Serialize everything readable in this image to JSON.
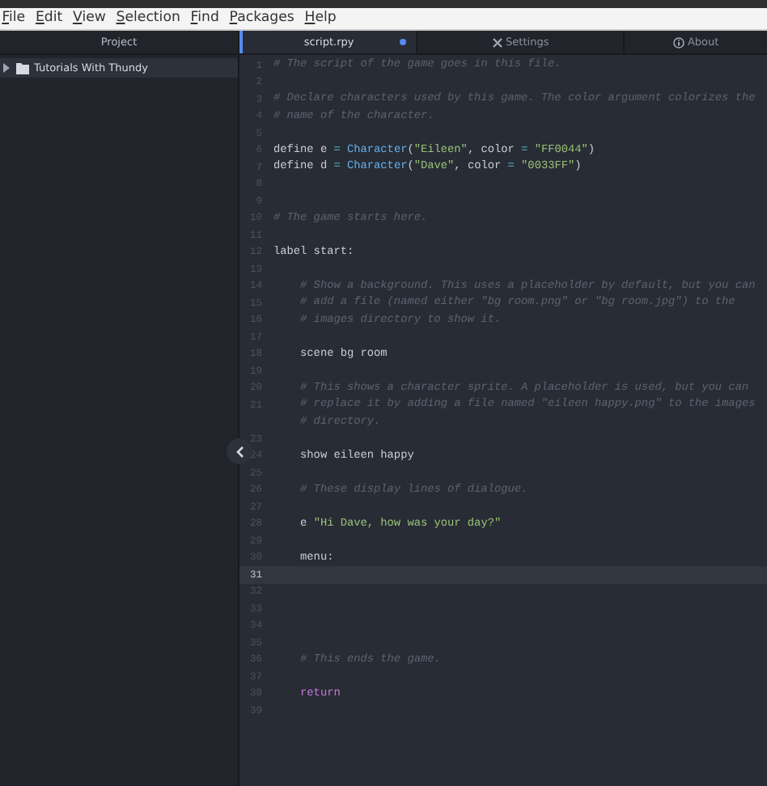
{
  "menu_bar": {
    "items": [
      "File",
      "Edit",
      "View",
      "Selection",
      "Find",
      "Packages",
      "Help"
    ]
  },
  "project_panel": {
    "title": "Project",
    "tree": [
      {
        "label": "Tutorials With Thundy",
        "expanded": false,
        "selected": true
      }
    ]
  },
  "tabs": [
    {
      "label": "script.rpy",
      "kind": "file",
      "selected": true,
      "modified": true
    },
    {
      "label": "Settings",
      "kind": "settings",
      "selected": false,
      "modified": false
    },
    {
      "label": "About",
      "kind": "about",
      "selected": false,
      "modified": false
    }
  ],
  "editor": {
    "lines": [
      {
        "number": "1",
        "current": false,
        "tokens": [
          {
            "kind": "comment",
            "text": "# The script of the game goes in this file."
          }
        ]
      },
      {
        "number": "2",
        "current": false
      },
      {
        "number": "3",
        "current": false,
        "tokens": [
          {
            "kind": "comment",
            "text": "# Declare characters used by this game. The color argument colorizes the"
          }
        ]
      },
      {
        "number": "4",
        "current": false,
        "tokens": [
          {
            "kind": "comment",
            "text": "# name of the character."
          }
        ]
      },
      {
        "number": "5",
        "current": false
      },
      {
        "number": "6",
        "current": false,
        "tokens": [
          {
            "kind": "plain",
            "text": "define e "
          },
          {
            "kind": "op",
            "text": "= "
          },
          {
            "kind": "func",
            "text": "Character"
          },
          {
            "kind": "plain",
            "text": "("
          },
          {
            "kind": "string",
            "text": "\"Eileen\""
          },
          {
            "kind": "plain",
            "text": ", color "
          },
          {
            "kind": "op",
            "text": "= "
          },
          {
            "kind": "string",
            "text": "\"FF0044\""
          },
          {
            "kind": "plain",
            "text": ")"
          }
        ]
      },
      {
        "number": "7",
        "current": false,
        "tokens": [
          {
            "kind": "plain",
            "text": "define d "
          },
          {
            "kind": "op",
            "text": "= "
          },
          {
            "kind": "func",
            "text": "Character"
          },
          {
            "kind": "plain",
            "text": "("
          },
          {
            "kind": "string",
            "text": "\"Dave\""
          },
          {
            "kind": "plain",
            "text": ", color "
          },
          {
            "kind": "op",
            "text": "= "
          },
          {
            "kind": "string",
            "text": "\"0033FF\""
          },
          {
            "kind": "plain",
            "text": ")"
          }
        ]
      },
      {
        "number": "8",
        "current": false
      },
      {
        "number": "9",
        "current": false
      },
      {
        "number": "10",
        "current": false,
        "tokens": [
          {
            "kind": "comment",
            "text": "# The game starts here."
          }
        ]
      },
      {
        "number": "11",
        "current": false
      },
      {
        "number": "12",
        "current": false,
        "tokens": [
          {
            "kind": "plain",
            "text": "label start:"
          }
        ]
      },
      {
        "number": "13",
        "current": false
      },
      {
        "number": "14",
        "current": false,
        "tokens": [
          {
            "kind": "comment",
            "text": "    # Show a background. This uses a placeholder by default, but you can"
          }
        ]
      },
      {
        "number": "15",
        "current": false,
        "tokens": [
          {
            "kind": "comment",
            "text": "    # add a file (named either \"bg room.png\" or \"bg room.jpg\") to the"
          }
        ]
      },
      {
        "number": "16",
        "current": false,
        "tokens": [
          {
            "kind": "comment",
            "text": "    # images directory to show it."
          }
        ]
      },
      {
        "number": "17",
        "current": false
      },
      {
        "number": "18",
        "current": false,
        "tokens": [
          {
            "kind": "plain",
            "text": "    scene bg room"
          }
        ]
      },
      {
        "number": "19",
        "current": false
      },
      {
        "number": "20",
        "current": false,
        "tokens": [
          {
            "kind": "comment",
            "text": "    # This shows a character sprite. A placeholder is used, but you can"
          }
        ]
      },
      {
        "number": "21",
        "current": false,
        "tokens": [
          {
            "kind": "comment",
            "text": "    # replace it by adding a file named \"eileen happy.png\" to the images"
          }
        ]
      },
      {
        "tokens": [
          {
            "kind": "comment",
            "text": "    # directory."
          }
        ]
      },
      {
        "number": "23",
        "current": false
      },
      {
        "number": "24",
        "current": false,
        "tokens": [
          {
            "kind": "plain",
            "text": "    show eileen happy"
          }
        ]
      },
      {
        "number": "25",
        "current": false
      },
      {
        "number": "26",
        "current": false,
        "tokens": [
          {
            "kind": "comment",
            "text": "    # These display lines of dialogue."
          }
        ]
      },
      {
        "number": "27",
        "current": false
      },
      {
        "number": "28",
        "current": false,
        "tokens": [
          {
            "kind": "plain",
            "text": "    e "
          },
          {
            "kind": "string",
            "text": "\"Hi Dave, how was your day?\""
          }
        ]
      },
      {
        "number": "29",
        "current": false
      },
      {
        "number": "30",
        "current": false,
        "tokens": [
          {
            "kind": "plain",
            "text": "    menu:"
          }
        ]
      },
      {
        "number": "31",
        "current": true
      },
      {
        "number": "32",
        "current": false
      },
      {
        "number": "33",
        "current": false
      },
      {
        "number": "34",
        "current": false
      },
      {
        "number": "35",
        "current": false
      },
      {
        "number": "36",
        "current": false,
        "tokens": [
          {
            "kind": "comment",
            "text": "    # This ends the game."
          }
        ]
      },
      {
        "number": "37",
        "current": false
      },
      {
        "number": "38",
        "current": false,
        "tokens": [
          {
            "kind": "keyword",
            "text": "    return"
          }
        ]
      },
      {
        "number": "39",
        "current": false
      }
    ]
  }
}
